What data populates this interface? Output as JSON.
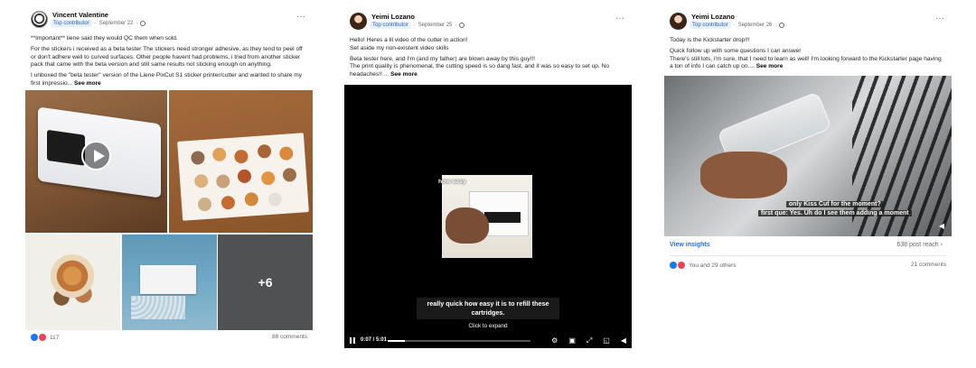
{
  "post1": {
    "author": "Vincent Valentine",
    "badge": "Top contributor",
    "date": "September 22",
    "paragraphs": [
      "**Important** liene said they would QC them when sold.",
      "For the stickers i received as a beta tester The stickers need stronger adhesive, as they tend to peel off or don't adhere well to curved surfaces. Other people havent had problems, i tried from another sticker pack that came with the beta version and still same results not sticking enough on anything.",
      "I unboxed the \"beta tester\" version of the Liene PixCut S1 sticker printer/cutter and wanted to share my first impressio..."
    ],
    "see_more": "See more",
    "more_photos": "+6",
    "reactions_count": "117",
    "comments": "88 comments"
  },
  "post2": {
    "author": "Yeimi Lozano",
    "badge": "Top contributor",
    "date": "September 25",
    "paragraphs": [
      "Hello! Heres a lil video of the cutter in action!",
      "Set aside my non-existent video skills",
      "Beta tester here, and I'm (and my father) are blown away by this guy!!!",
      "The print quality is phenomenal, the cutting speed is so dang fast, and it was so easy to set up. No headaches!! ..."
    ],
    "see_more": "See more",
    "video": {
      "inset_caption": "how easy",
      "caption": "really quick how easy it is to refill these cartridges.",
      "expand": "Click to expand",
      "time": "0:07 / 5:01",
      "progress": 0.12,
      "controls": [
        "gear-icon",
        "cc-icon",
        "fullscreen-icon",
        "pip-icon",
        "volume-icon"
      ]
    }
  },
  "post3": {
    "author": "Yeimi Lozano",
    "badge": "Top contributor",
    "date": "September 26",
    "paragraphs": [
      "Today is the Kickstarter drop!!!",
      "Quick follow up with some questions I can answer",
      "There's still lots, I'm sure, that I need to learn as well! I'm looking forward to the Kickstarter page having a ton of info I can catch up on...."
    ],
    "see_more": "See more",
    "video_caption_1": "only Kiss Cut for the moment?",
    "video_caption_2": "first que: Yes. Uh do I see them adding a  moment",
    "view_insights": "View insights",
    "post_reach": "638 post reach",
    "reactions_text": "You and 29 others",
    "comments": "21 comments"
  }
}
